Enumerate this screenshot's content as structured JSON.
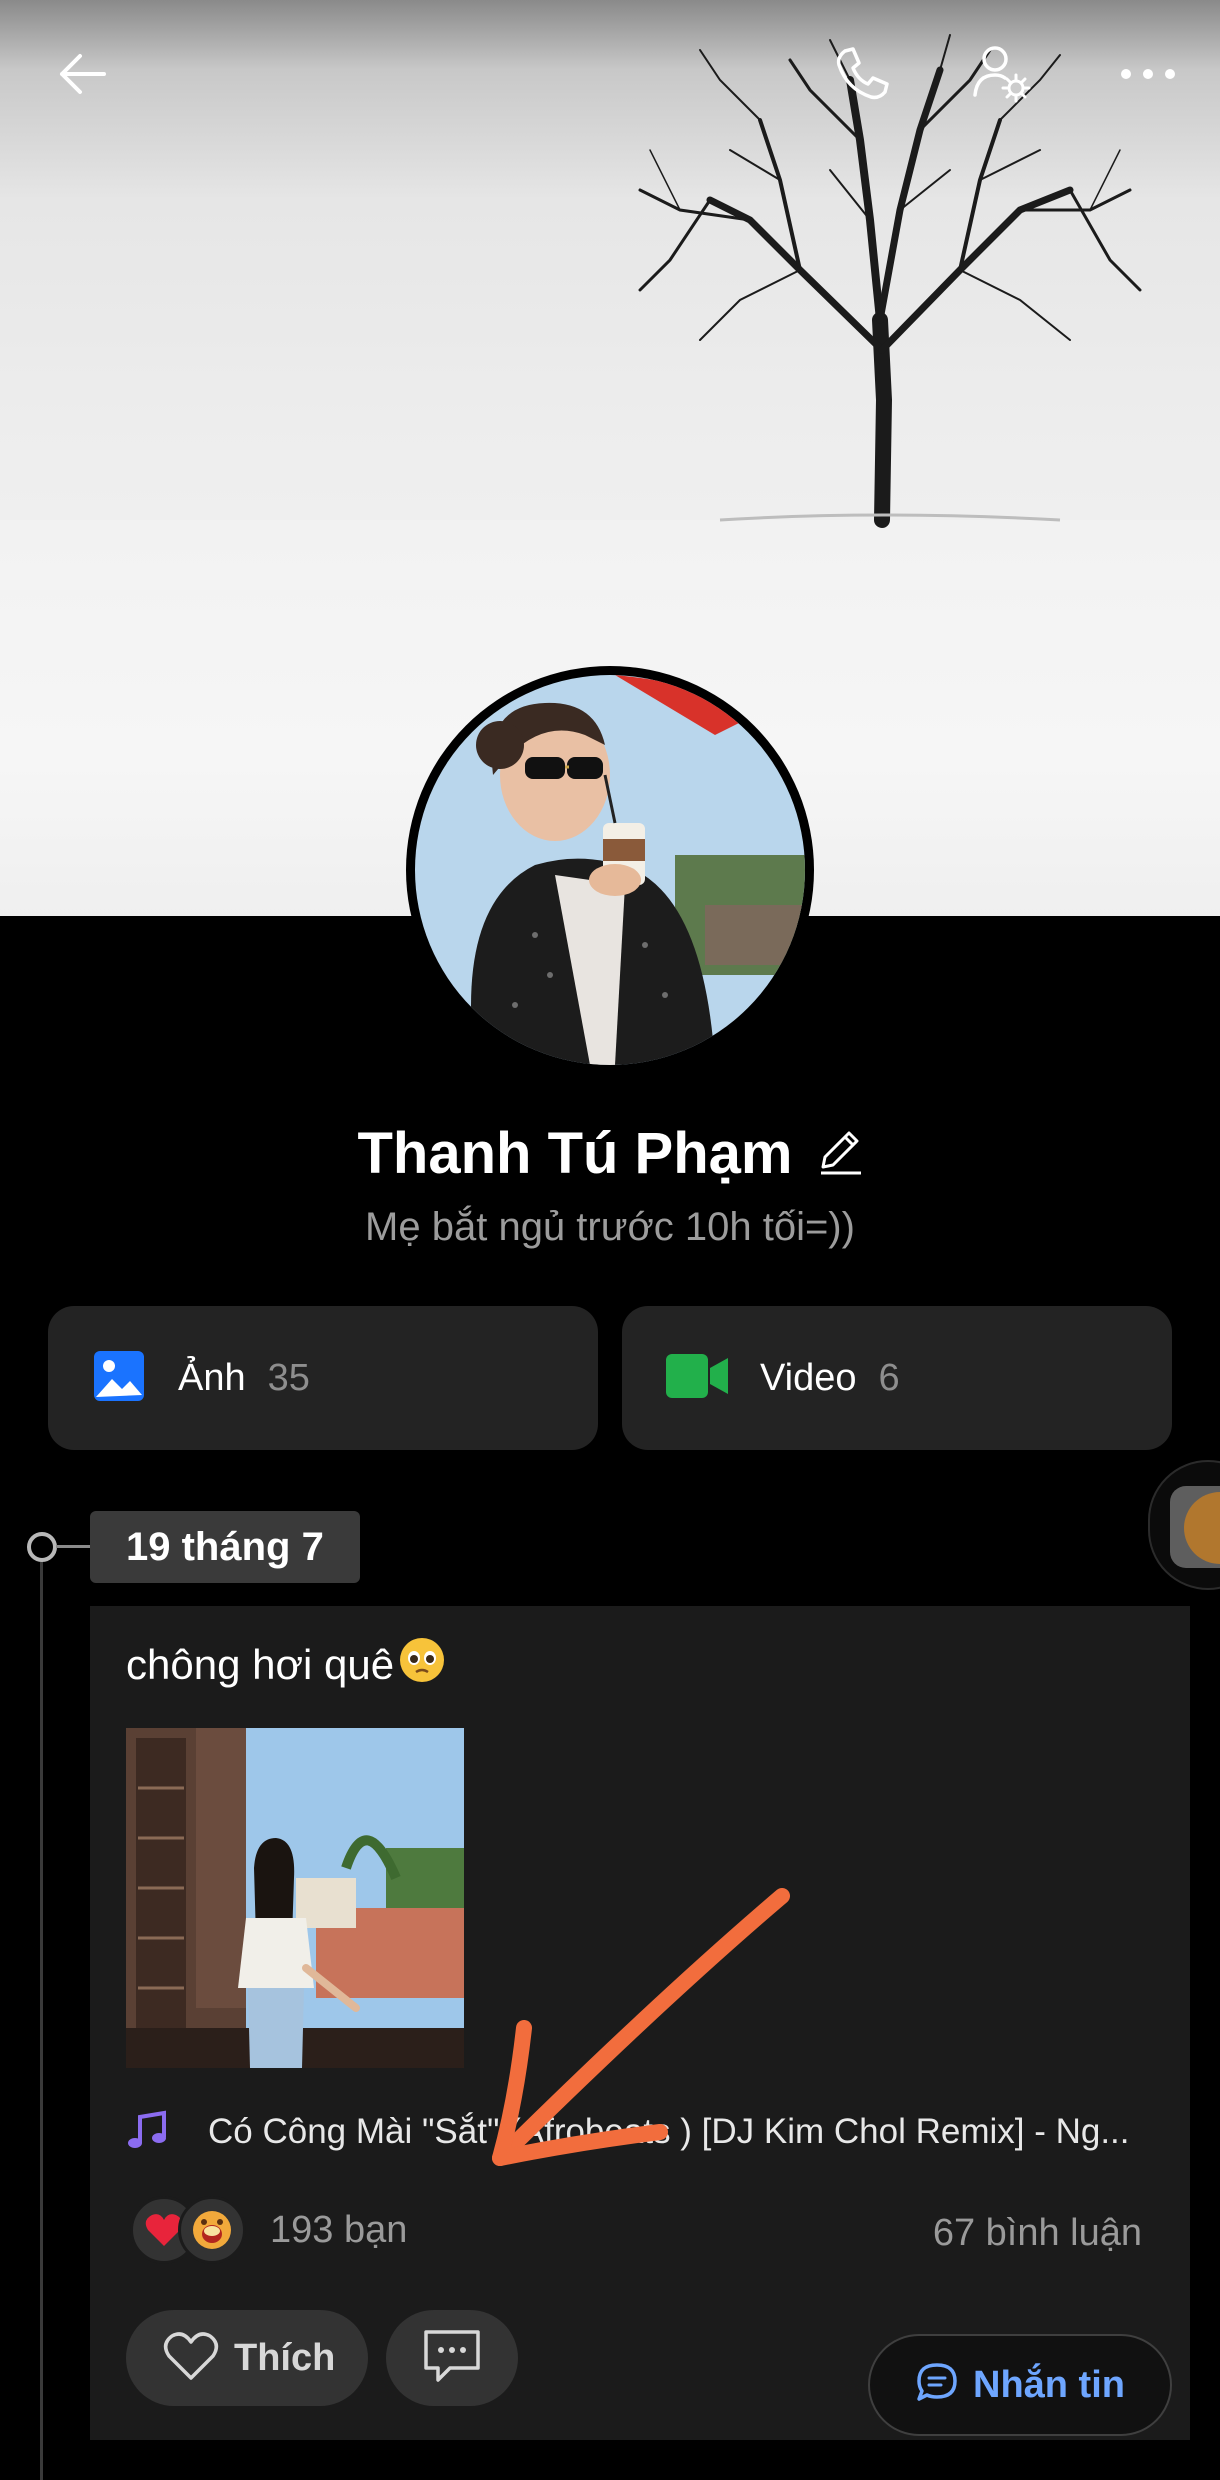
{
  "profile": {
    "name": "Thanh Tú Phạm",
    "bio": "Mẹ bắt ngủ trước 10h tối=))"
  },
  "media": {
    "photos": {
      "label": "Ảnh",
      "count": "35",
      "icon": "image-icon",
      "color": "#1a73ff"
    },
    "videos": {
      "label": "Video",
      "count": "6",
      "icon": "video-camera-icon",
      "color": "#22b04b"
    }
  },
  "timeline": {
    "date": "19 tháng 7"
  },
  "post": {
    "text": "chông hơi quê",
    "music": "Có Công Mài \"Sắt\" (Afrobeats ) [DJ Kim Chol Remix] - Ng...",
    "reactions_count": "193 bạn",
    "comments_count": "67 bình luận",
    "like_label": "Thích"
  },
  "actions": {
    "message_label": "Nhắn tin"
  },
  "colors": {
    "accent_blue": "#6ea6ff",
    "annotation_arrow": "#f26d3d",
    "card_bg": "#1b1b1b"
  }
}
